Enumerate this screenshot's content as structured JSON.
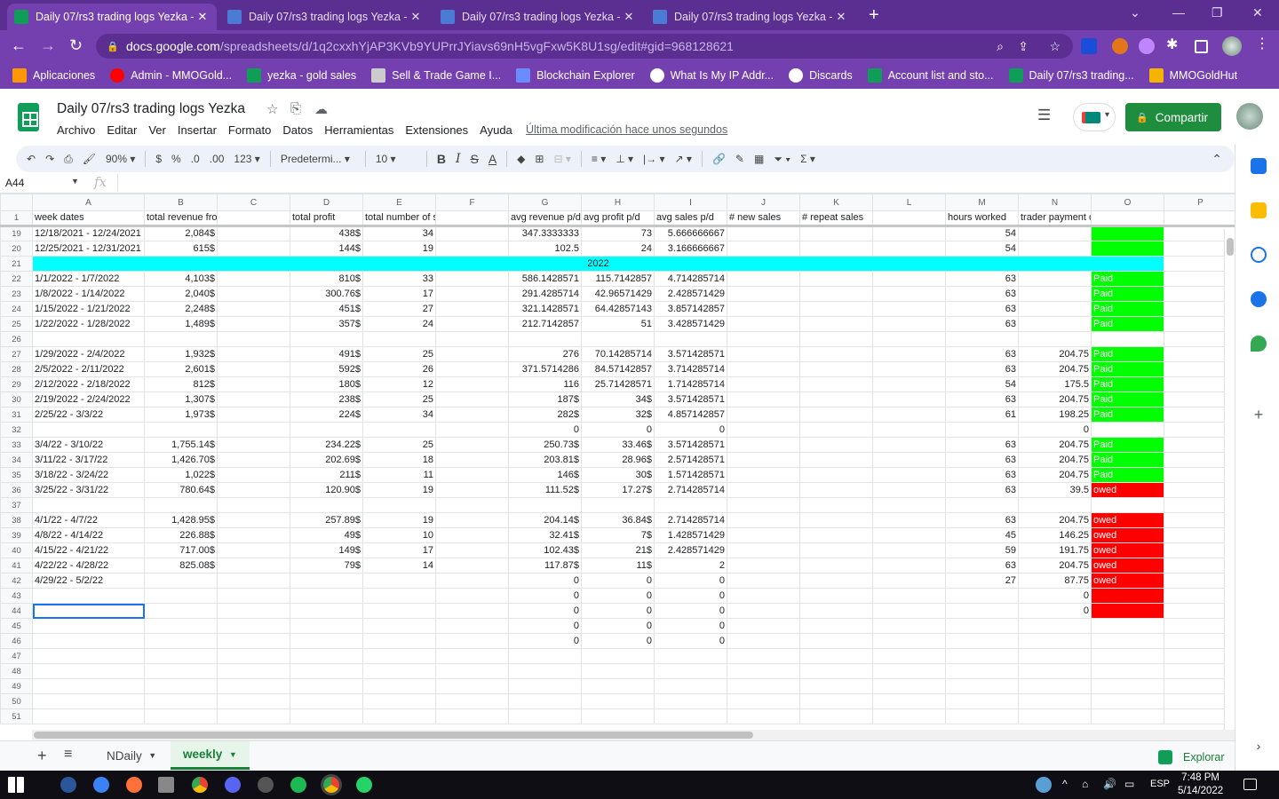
{
  "browser": {
    "tabs": [
      {
        "title": "Daily 07/rs3 trading logs Yezka -",
        "active": true
      },
      {
        "title": "Daily 07/rs3 trading logs Yezka -",
        "active": false
      },
      {
        "title": "Daily 07/rs3 trading logs Yezka -",
        "active": false
      },
      {
        "title": "Daily 07/rs3 trading logs Yezka -",
        "active": false
      }
    ],
    "new_tab": "+",
    "url_host": "docs.google.com",
    "url_rest": "/spreadsheets/d/1q2cxxhYjAP3KVb9YUPrrJYiavs69nH5vgFxw5K8U1sg/edit#gid=968128621",
    "bookmarks": [
      {
        "label": "Aplicaciones",
        "icon": "apps-grid-icon",
        "color": "#ff9800"
      },
      {
        "label": "Admin - MMOGold...",
        "icon": "youtube-icon",
        "color": "#ff0000"
      },
      {
        "label": "yezka - gold sales",
        "icon": "sheets-icon",
        "color": "#0f9d58"
      },
      {
        "label": "Sell & Trade Game I...",
        "icon": "shield-icon",
        "color": "#cccccc"
      },
      {
        "label": "Blockchain Explorer",
        "icon": "cube-icon",
        "color": "#6b8cff"
      },
      {
        "label": "What Is My IP Addr...",
        "icon": "globe-icon",
        "color": "#ffffff"
      },
      {
        "label": "Discards",
        "icon": "globe-icon",
        "color": "#ffffff"
      },
      {
        "label": "Account list and sto...",
        "icon": "sheets-icon",
        "color": "#0f9d58"
      },
      {
        "label": "Daily 07/rs3 trading...",
        "icon": "sheets-icon",
        "color": "#0f9d58"
      },
      {
        "label": "MMOGoldHut",
        "icon": "mmo-icon",
        "color": "#f4b400"
      }
    ]
  },
  "doc": {
    "title": "Daily 07/rs3 trading logs Yezka",
    "menus": [
      "Archivo",
      "Editar",
      "Ver",
      "Insertar",
      "Formato",
      "Datos",
      "Herramientas",
      "Extensiones",
      "Ayuda"
    ],
    "last_modified": "Última modificación hace unos segundos",
    "share_label": "Compartir"
  },
  "toolbar": {
    "zoom": "90%",
    "currency": "$",
    "percent": "%",
    "dec_less": ".0",
    "dec_more": ".00",
    "format_more": "123",
    "font": "Predetermi...",
    "font_size": "10",
    "bold": "B",
    "italic": "I",
    "strike": "S",
    "text_color": "A"
  },
  "formula_bar": {
    "cell_ref": "A44",
    "fx": "fx",
    "value": ""
  },
  "sheet": {
    "columns": [
      "A",
      "B",
      "C",
      "D",
      "E",
      "F",
      "G",
      "H",
      "I",
      "J",
      "K",
      "L",
      "M",
      "N",
      "O",
      "P"
    ],
    "header_row": {
      "n": "1",
      "cells": [
        "week dates",
        "total revenue from trades",
        "",
        "total profit",
        "total number of sales",
        "",
        "avg revenue p/d",
        "avg profit p/d",
        "avg sales p/d",
        "# new sales",
        "# repeat sales",
        "",
        "hours worked",
        "trader payment owed",
        "",
        ""
      ]
    },
    "rows": [
      {
        "n": "19",
        "cells": [
          "12/18/2021 - 12/24/2021",
          "2,084$",
          "",
          "438$",
          "34",
          "",
          "347.3333333",
          "73",
          "5.666666667",
          "",
          "",
          "",
          "54",
          "",
          "",
          ""
        ],
        "status": "green"
      },
      {
        "n": "20",
        "cells": [
          "12/25/2021 - 12/31/2021",
          "615$",
          "",
          "144$",
          "19",
          "",
          "102.5",
          "24",
          "3.166666667",
          "",
          "",
          "",
          "54",
          "",
          "",
          ""
        ],
        "status": "green"
      },
      {
        "n": "21",
        "cells": [
          "",
          "",
          "",
          "",
          "",
          "",
          "2022",
          "",
          "",
          "",
          "",
          "",
          "",
          "",
          "",
          ""
        ],
        "band": true
      },
      {
        "n": "22",
        "cells": [
          "1/1/2022 - 1/7/2022",
          "4,103$",
          "",
          "810$",
          "33",
          "",
          "586.1428571",
          "115.7142857",
          "4.714285714",
          "",
          "",
          "",
          "63",
          "",
          "Paid",
          ""
        ],
        "status": "green"
      },
      {
        "n": "23",
        "cells": [
          "1/8/2022 - 1/14/2022",
          "2,040$",
          "",
          "300.76$",
          "17",
          "",
          "291.4285714",
          "42.96571429",
          "2.428571429",
          "",
          "",
          "",
          "63",
          "",
          "Paid",
          ""
        ],
        "status": "green"
      },
      {
        "n": "24",
        "cells": [
          "1/15/2022 - 1/21/2022",
          "2,248$",
          "",
          "451$",
          "27",
          "",
          "321.1428571",
          "64.42857143",
          "3.857142857",
          "",
          "",
          "",
          "63",
          "",
          "Paid",
          ""
        ],
        "status": "green"
      },
      {
        "n": "25",
        "cells": [
          "1/22/2022 - 1/28/2022",
          "1,489$",
          "",
          "357$",
          "24",
          "",
          "212.7142857",
          "51",
          "3.428571429",
          "",
          "",
          "",
          "63",
          "",
          "Paid",
          ""
        ],
        "status": "green"
      },
      {
        "n": "26",
        "cells": [
          "",
          "",
          "",
          "",
          "",
          "",
          "",
          "",
          "",
          "",
          "",
          "",
          "",
          "",
          "",
          ""
        ],
        "status": ""
      },
      {
        "n": "27",
        "cells": [
          "1/29/2022 - 2/4/2022",
          "1,932$",
          "",
          "491$",
          "25",
          "",
          "276",
          "70.14285714",
          "3.571428571",
          "",
          "",
          "",
          "63",
          "204.75",
          "Paid",
          ""
        ],
        "status": "green"
      },
      {
        "n": "28",
        "cells": [
          "2/5/2022 - 2/11/2022",
          "2,601$",
          "",
          "592$",
          "26",
          "",
          "371.5714286",
          "84.57142857",
          "3.714285714",
          "",
          "",
          "",
          "63",
          "204.75",
          "Paid",
          ""
        ],
        "status": "green"
      },
      {
        "n": "29",
        "cells": [
          "2/12/2022 - 2/18/2022",
          "812$",
          "",
          "180$",
          "12",
          "",
          "116",
          "25.71428571",
          "1.714285714",
          "",
          "",
          "",
          "54",
          "175.5",
          "Paid",
          ""
        ],
        "status": "green"
      },
      {
        "n": "30",
        "cells": [
          "2/19/2022 - 2/24/2022",
          "1,307$",
          "",
          "238$",
          "25",
          "",
          "187$",
          "34$",
          "3.571428571",
          "",
          "",
          "",
          "63",
          "204.75",
          "Paid",
          ""
        ],
        "status": "green"
      },
      {
        "n": "31",
        "cells": [
          "2/25/22 - 3/3/22",
          "1,973$",
          "",
          "224$",
          "34",
          "",
          "282$",
          "32$",
          "4.857142857",
          "",
          "",
          "",
          "61",
          "198.25",
          "Paid",
          ""
        ],
        "status": "green"
      },
      {
        "n": "32",
        "cells": [
          "",
          "",
          "",
          "",
          "",
          "",
          "0",
          "0",
          "0",
          "",
          "",
          "",
          "",
          "0",
          "",
          ""
        ],
        "status": ""
      },
      {
        "n": "33",
        "cells": [
          "3/4/22 - 3/10/22",
          "1,755.14$",
          "",
          "234.22$",
          "25",
          "",
          "250.73$",
          "33.46$",
          "3.571428571",
          "",
          "",
          "",
          "63",
          "204.75",
          "Paid",
          ""
        ],
        "status": "green"
      },
      {
        "n": "34",
        "cells": [
          "3/11/22 - 3/17/22",
          "1,426.70$",
          "",
          "202.69$",
          "18",
          "",
          "203.81$",
          "28.96$",
          "2.571428571",
          "",
          "",
          "",
          "63",
          "204.75",
          "Paid",
          ""
        ],
        "status": "green"
      },
      {
        "n": "35",
        "cells": [
          "3/18/22 - 3/24/22",
          "1,022$",
          "",
          "211$",
          "11",
          "",
          "146$",
          "30$",
          "1.571428571",
          "",
          "",
          "",
          "63",
          "204.75",
          "Paid",
          ""
        ],
        "status": "green"
      },
      {
        "n": "36",
        "cells": [
          "3/25/22 - 3/31/22",
          "780.64$",
          "",
          "120.90$",
          "19",
          "",
          "111.52$",
          "17.27$",
          "2.714285714",
          "",
          "",
          "",
          "63",
          "39.5",
          "owed",
          ""
        ],
        "status": "red"
      },
      {
        "n": "37",
        "cells": [
          "",
          "",
          "",
          "",
          "",
          "",
          "",
          "",
          "",
          "",
          "",
          "",
          "",
          "",
          "",
          ""
        ],
        "status": ""
      },
      {
        "n": "38",
        "cells": [
          "4/1/22 - 4/7/22",
          "1,428.95$",
          "",
          "257.89$",
          "19",
          "",
          "204.14$",
          "36.84$",
          "2.714285714",
          "",
          "",
          "",
          "63",
          "204.75",
          "owed",
          ""
        ],
        "status": "red"
      },
      {
        "n": "39",
        "cells": [
          "4/8/22 - 4/14/22",
          "226.88$",
          "",
          "49$",
          "10",
          "",
          "32.41$",
          "7$",
          "1.428571429",
          "",
          "",
          "",
          "45",
          "146.25",
          "owed",
          ""
        ],
        "status": "red"
      },
      {
        "n": "40",
        "cells": [
          "4/15/22 - 4/21/22",
          "717.00$",
          "",
          "149$",
          "17",
          "",
          "102.43$",
          "21$",
          "2.428571429",
          "",
          "",
          "",
          "59",
          "191.75",
          "owed",
          ""
        ],
        "status": "red"
      },
      {
        "n": "41",
        "cells": [
          "4/22/22 - 4/28/22",
          "825.08$",
          "",
          "79$",
          "14",
          "",
          "117.87$",
          "11$",
          "2",
          "",
          "",
          "",
          "63",
          "204.75",
          "owed",
          ""
        ],
        "status": "red"
      },
      {
        "n": "42",
        "cells": [
          "4/29/22 - 5/2/22",
          "",
          "",
          "",
          "",
          "",
          "0",
          "0",
          "0",
          "",
          "",
          "",
          "27",
          "87.75",
          "owed",
          ""
        ],
        "status": "red"
      },
      {
        "n": "43",
        "cells": [
          "",
          "",
          "",
          "",
          "",
          "",
          "0",
          "0",
          "0",
          "",
          "",
          "",
          "",
          "0",
          "",
          ""
        ],
        "status": "red"
      },
      {
        "n": "44",
        "cells": [
          "",
          "",
          "",
          "",
          "",
          "",
          "0",
          "0",
          "0",
          "",
          "",
          "",
          "",
          "0",
          "",
          ""
        ],
        "status": "red",
        "selected": true
      },
      {
        "n": "45",
        "cells": [
          "",
          "",
          "",
          "",
          "",
          "",
          "0",
          "0",
          "0",
          "",
          "",
          "",
          "",
          "",
          "",
          ""
        ],
        "status": ""
      },
      {
        "n": "46",
        "cells": [
          "",
          "",
          "",
          "",
          "",
          "",
          "0",
          "0",
          "0",
          "",
          "",
          "",
          "",
          "",
          "",
          ""
        ],
        "status": ""
      },
      {
        "n": "47",
        "cells": [
          "",
          "",
          "",
          "",
          "",
          "",
          "",
          "",
          "",
          "",
          "",
          "",
          "",
          "",
          "",
          ""
        ],
        "status": ""
      },
      {
        "n": "48",
        "cells": [
          "",
          "",
          "",
          "",
          "",
          "",
          "",
          "",
          "",
          "",
          "",
          "",
          "",
          "",
          "",
          ""
        ],
        "status": ""
      },
      {
        "n": "49",
        "cells": [
          "",
          "",
          "",
          "",
          "",
          "",
          "",
          "",
          "",
          "",
          "",
          "",
          "",
          "",
          "",
          ""
        ],
        "status": ""
      },
      {
        "n": "50",
        "cells": [
          "",
          "",
          "",
          "",
          "",
          "",
          "",
          "",
          "",
          "",
          "",
          "",
          "",
          "",
          "",
          ""
        ],
        "status": ""
      },
      {
        "n": "51",
        "cells": [
          "",
          "",
          "",
          "",
          "",
          "",
          "",
          "",
          "",
          "",
          "",
          "",
          "",
          "",
          "",
          ""
        ],
        "status": ""
      }
    ],
    "colors": {
      "paid": "#00ff00",
      "owed": "#ff0000",
      "year_band": "#00ffff"
    }
  },
  "sheet_tabs": [
    {
      "label": "NDaily",
      "active": false
    },
    {
      "label": "weekly",
      "active": true
    }
  ],
  "explore_label": "Explorar",
  "taskbar": {
    "time": "7:48 PM",
    "date": "5/14/2022",
    "lang": "ESP"
  }
}
